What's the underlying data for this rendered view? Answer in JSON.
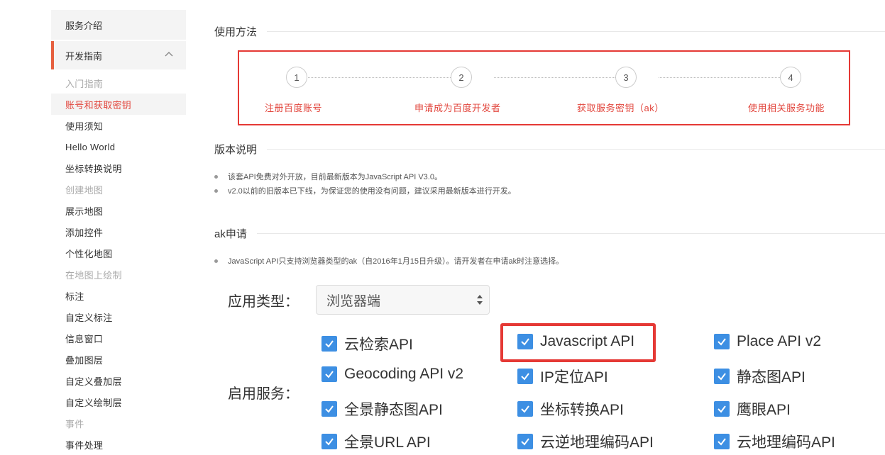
{
  "sidebar": {
    "top_item": "服务介绍",
    "group": {
      "label": "开发指南",
      "expanded": true
    },
    "items": [
      {
        "label": "入门指南",
        "state": "muted"
      },
      {
        "label": "账号和获取密钥",
        "state": "active"
      },
      {
        "label": "使用须知",
        "state": "normal"
      },
      {
        "label": "Hello World",
        "state": "normal"
      },
      {
        "label": "坐标转换说明",
        "state": "normal"
      },
      {
        "label": "创建地图",
        "state": "muted"
      },
      {
        "label": "展示地图",
        "state": "normal"
      },
      {
        "label": "添加控件",
        "state": "normal"
      },
      {
        "label": "个性化地图",
        "state": "normal"
      },
      {
        "label": "在地图上绘制",
        "state": "muted"
      },
      {
        "label": "标注",
        "state": "normal"
      },
      {
        "label": "自定义标注",
        "state": "normal"
      },
      {
        "label": "信息窗口",
        "state": "normal"
      },
      {
        "label": "叠加图层",
        "state": "normal"
      },
      {
        "label": "自定义叠加层",
        "state": "normal"
      },
      {
        "label": "自定义绘制层",
        "state": "normal"
      },
      {
        "label": "事件",
        "state": "muted"
      },
      {
        "label": "事件处理",
        "state": "normal"
      }
    ]
  },
  "usage": {
    "title": "使用方法",
    "steps": [
      {
        "num": "1",
        "label": "注册百度账号"
      },
      {
        "num": "2",
        "label": "申请成为百度开发者"
      },
      {
        "num": "3",
        "label": "获取服务密钥（ak）"
      },
      {
        "num": "4",
        "label": "使用相关服务功能"
      }
    ]
  },
  "version": {
    "title": "版本说明",
    "bullets": [
      "该套API免费对外开放，目前最新版本为JavaScript API V3.0。",
      "v2.0以前的旧版本已下线，为保证您的使用没有问题，建议采用最新版本进行开发。"
    ]
  },
  "ak": {
    "title": "ak申请",
    "bullets": [
      "JavaScript API只支持浏览器类型的ak（自2016年1月15日升级）。请开发者在申请ak时注意选择。"
    ]
  },
  "form": {
    "app_type_label": "应用类型：",
    "app_type_value": "浏览器端",
    "services_label": "启用服务：",
    "services": [
      [
        "云检索API",
        "Javascript API",
        "Place API v2"
      ],
      [
        "Geocoding API v2",
        "IP定位API",
        "静态图API"
      ],
      [
        "全景静态图API",
        "坐标转换API",
        "鹰眼API"
      ],
      [
        "全景URL API",
        "云逆地理编码API",
        "云地理编码API"
      ]
    ],
    "checked": true
  },
  "colors": {
    "accent_red": "#e53935",
    "link_red": "#e2453c",
    "checkbox_blue": "#3d8fe3"
  }
}
